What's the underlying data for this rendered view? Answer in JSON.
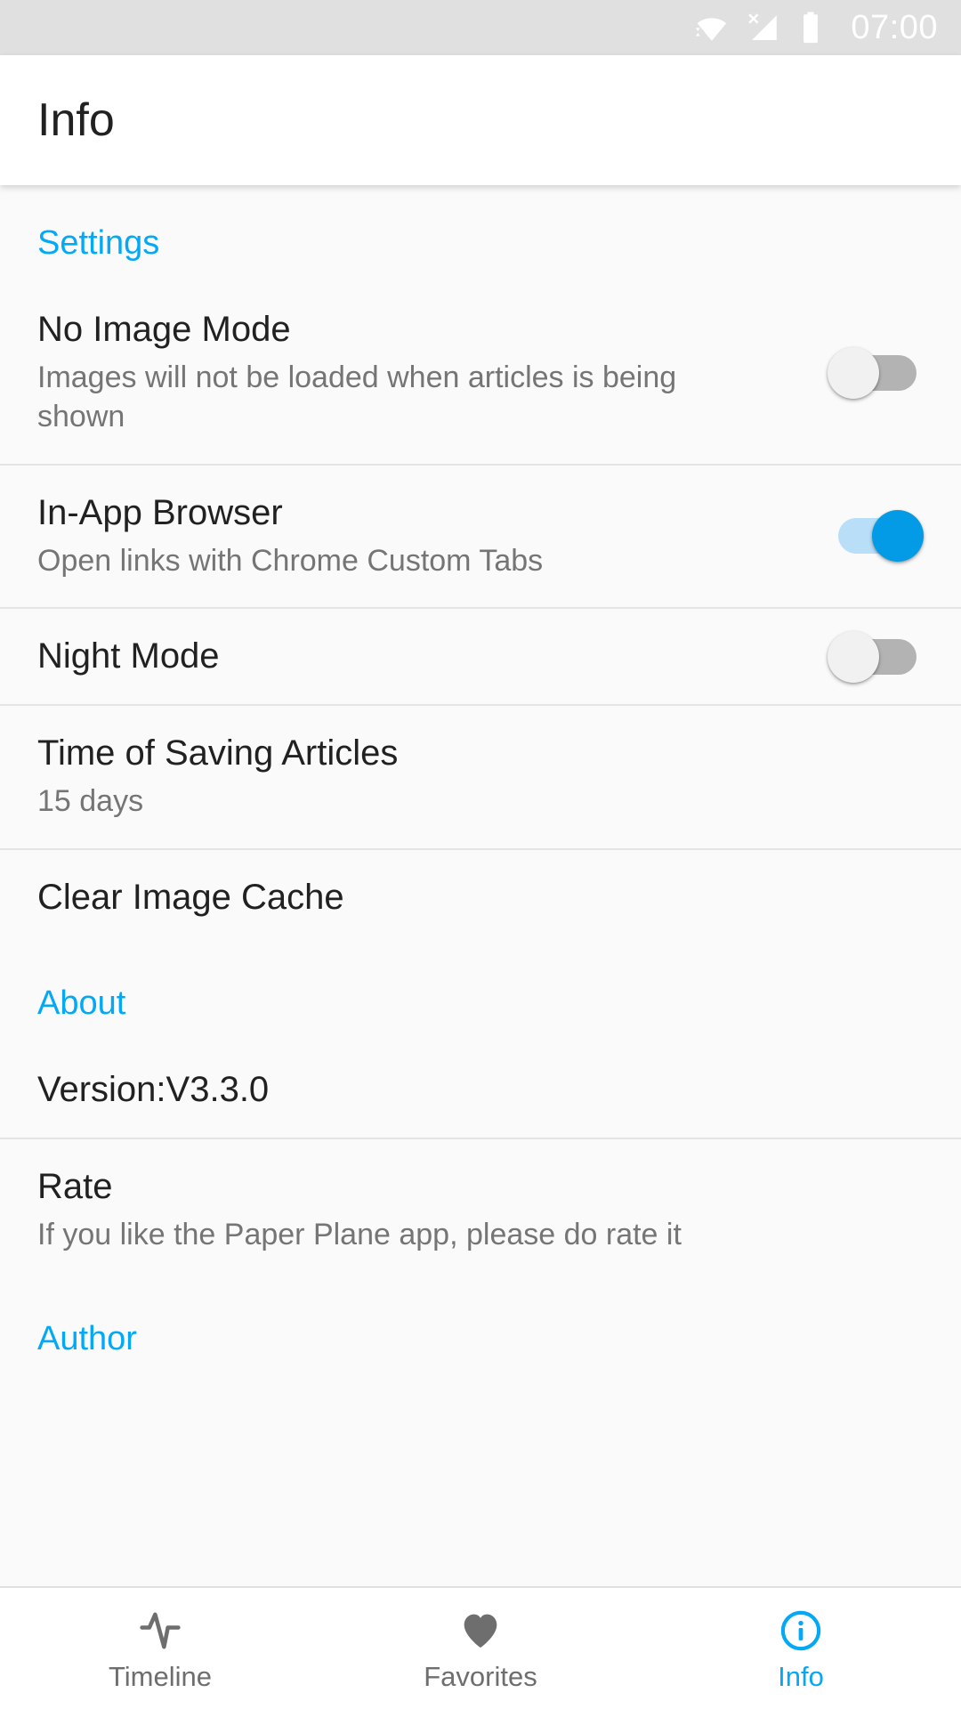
{
  "status_bar": {
    "time": "07:00",
    "icons": [
      {
        "name": "wifi-icon",
        "label": "wifi"
      },
      {
        "name": "cellular-no-signal-icon",
        "label": "no-signal"
      },
      {
        "name": "battery-icon",
        "label": "battery"
      }
    ],
    "background_color": "#e0e0e0",
    "foreground_color": "#ffffff"
  },
  "app_bar": {
    "title": "Info"
  },
  "theme": {
    "accent": "#03a9f4",
    "page_background": "#fafafa",
    "primary_text": "#212121",
    "secondary_text": "#757575",
    "switch_on_track": "#b9def8",
    "switch_on_thumb": "#039be5",
    "switch_off_track": "#b3b3b3",
    "switch_off_thumb": "#f1f1f1"
  },
  "sections": {
    "settings": {
      "header": "Settings",
      "rows": [
        {
          "name": "no-image-mode",
          "title": "No Image Mode",
          "subtitle": "Images will not be loaded when articles is being shown",
          "control": "switch",
          "value": "off"
        },
        {
          "name": "in-app-browser",
          "title": "In-App Browser",
          "subtitle": "Open links with Chrome Custom Tabs",
          "control": "switch",
          "value": "on"
        },
        {
          "name": "night-mode",
          "title": "Night Mode",
          "subtitle": "",
          "control": "switch",
          "value": "off"
        },
        {
          "name": "time-of-saving-articles",
          "title": "Time of Saving Articles",
          "subtitle": "15 days",
          "control": "none",
          "value": ""
        },
        {
          "name": "clear-image-cache",
          "title": "Clear Image Cache",
          "subtitle": "",
          "control": "none",
          "value": ""
        }
      ]
    },
    "about": {
      "header": "About",
      "rows": [
        {
          "name": "version",
          "title": "Version:V3.3.0",
          "subtitle": "",
          "control": "none",
          "value": ""
        },
        {
          "name": "rate",
          "title": "Rate",
          "subtitle": "If you like the Paper Plane app, please do rate it",
          "control": "none",
          "value": ""
        }
      ]
    },
    "author": {
      "header": "Author"
    }
  },
  "bottom_nav": {
    "items": [
      {
        "name": "timeline",
        "label": "Timeline",
        "icon": "activity-pulse-icon",
        "active": false
      },
      {
        "name": "favorites",
        "label": "Favorites",
        "icon": "heart-icon",
        "active": false
      },
      {
        "name": "info",
        "label": "Info",
        "icon": "info-circle-icon",
        "active": true
      }
    ]
  }
}
